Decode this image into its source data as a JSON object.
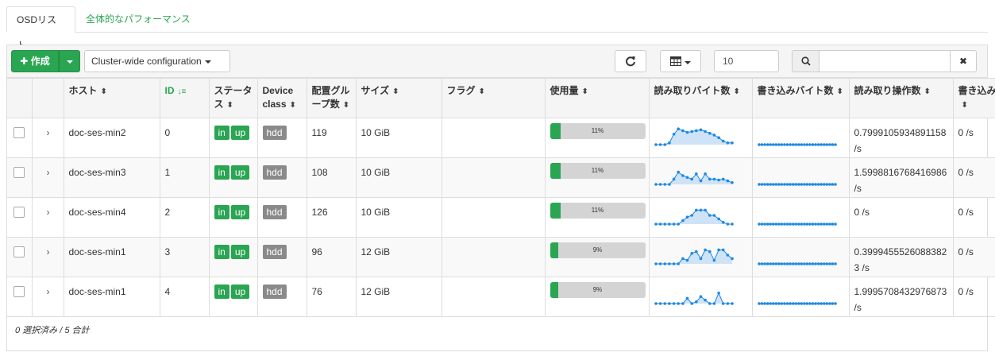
{
  "tabs": [
    "OSDリスト",
    "全体的なパフォーマンス"
  ],
  "toolbar": {
    "create_label": "作成",
    "cluster_label": "Cluster-wide configuration",
    "limit_value": "10",
    "search_value": ""
  },
  "columns": [
    "ホスト",
    "ID",
    "ステータス",
    "Device class",
    "配置グループ数",
    "サイズ",
    "フラグ",
    "使用量",
    "読み取りバイト数",
    "書き込みバイト数",
    "読み取り操作数",
    "書き込み操作数"
  ],
  "rows": [
    {
      "host": "doc-ses-min2",
      "id": "0",
      "status": [
        "in",
        "up"
      ],
      "device_class": "hdd",
      "pgs": "119",
      "size": "10 GiB",
      "flags": "",
      "usage_label": "11%",
      "usage": 0.11,
      "read_ops": "0.7999105934891158 /s",
      "write_ops": "0 /s",
      "read_bytes": [
        0,
        0,
        0,
        0.1,
        0.6,
        0.9,
        0.8,
        0.7,
        0.75,
        0.8,
        0.85,
        0.75,
        0.65,
        0.55,
        0.4,
        0.2,
        0.1,
        0.1
      ],
      "write_bytes": [
        0,
        0,
        0,
        0,
        0,
        0,
        0,
        0,
        0,
        0,
        0,
        0,
        0,
        0,
        0,
        0,
        0,
        0,
        0,
        0,
        0,
        0,
        0,
        0,
        0,
        0,
        0,
        0
      ]
    },
    {
      "host": "doc-ses-min3",
      "id": "1",
      "status": [
        "in",
        "up"
      ],
      "device_class": "hdd",
      "pgs": "108",
      "size": "10 GiB",
      "flags": "",
      "usage_label": "11%",
      "usage": 0.11,
      "read_ops": "1.5998816768416986 /s",
      "write_ops": "0 /s",
      "read_bytes": [
        0,
        0,
        0,
        0,
        0.3,
        0.7,
        0.5,
        0.4,
        0.3,
        0.6,
        0.2,
        0.6,
        0.3,
        0.3,
        0.25,
        0.3,
        0.2,
        0.1
      ],
      "write_bytes": [
        0,
        0,
        0,
        0,
        0,
        0,
        0,
        0,
        0,
        0,
        0,
        0,
        0,
        0,
        0,
        0,
        0,
        0,
        0,
        0,
        0,
        0,
        0,
        0,
        0,
        0,
        0,
        0
      ]
    },
    {
      "host": "doc-ses-min4",
      "id": "2",
      "status": [
        "in",
        "up"
      ],
      "device_class": "hdd",
      "pgs": "126",
      "size": "10 GiB",
      "flags": "",
      "usage_label": "11%",
      "usage": 0.11,
      "read_ops": "0 /s",
      "write_ops": "0 /s",
      "read_bytes": [
        0,
        0,
        0,
        0,
        0,
        0,
        0.2,
        0.4,
        0.5,
        0.8,
        0.8,
        0.8,
        0.5,
        0.5,
        0.3,
        0.1,
        0,
        0
      ],
      "write_bytes": [
        0,
        0,
        0,
        0,
        0,
        0,
        0,
        0,
        0,
        0,
        0,
        0,
        0,
        0,
        0,
        0,
        0,
        0,
        0,
        0,
        0,
        0,
        0,
        0,
        0,
        0,
        0,
        0
      ]
    },
    {
      "host": "doc-ses-min1",
      "id": "3",
      "status": [
        "in",
        "up"
      ],
      "device_class": "hdd",
      "pgs": "96",
      "size": "12 GiB",
      "flags": "",
      "usage_label": "9%",
      "usage": 0.09,
      "read_ops": "0.39994555260883823 /s",
      "write_ops": "0 /s",
      "read_bytes": [
        0,
        0,
        0,
        0,
        0,
        0,
        0.3,
        0.2,
        0.6,
        0.7,
        0.3,
        0.8,
        0.7,
        0.2,
        0.8,
        0.8,
        0.5,
        0.3
      ],
      "write_bytes": [
        0,
        0,
        0,
        0,
        0,
        0,
        0,
        0,
        0,
        0,
        0,
        0,
        0,
        0,
        0,
        0,
        0,
        0,
        0,
        0,
        0,
        0,
        0,
        0,
        0,
        0,
        0,
        0
      ]
    },
    {
      "host": "doc-ses-min1",
      "id": "4",
      "status": [
        "in",
        "up"
      ],
      "device_class": "hdd",
      "pgs": "76",
      "size": "12 GiB",
      "flags": "",
      "usage_label": "9%",
      "usage": 0.09,
      "read_ops": "1.9995708432976873 /s",
      "write_ops": "0 /s",
      "read_bytes": [
        0,
        0,
        0,
        0,
        0,
        0,
        0,
        0.3,
        0,
        0.1,
        0.4,
        0.2,
        0,
        0,
        0.6,
        0,
        0,
        0
      ],
      "write_bytes": [
        0,
        0,
        0,
        0,
        0,
        0,
        0,
        0,
        0,
        0,
        0,
        0,
        0,
        0,
        0,
        0,
        0,
        0,
        0,
        0,
        0,
        0,
        0,
        0,
        0,
        0,
        0,
        0
      ]
    }
  ],
  "footer": "0 選択済み / 5 合計",
  "colors": {
    "accent": "#2aa552",
    "badge_gray": "#8a8a8a",
    "sparkline": "#1e88e5",
    "sparkline_fill": "#cfe3f7"
  },
  "icons": [
    "plus-icon",
    "refresh-icon",
    "table-columns-icon",
    "search-icon",
    "close-icon",
    "sort-icon",
    "sort-amount-asc-icon",
    "chevron-right-icon"
  ]
}
